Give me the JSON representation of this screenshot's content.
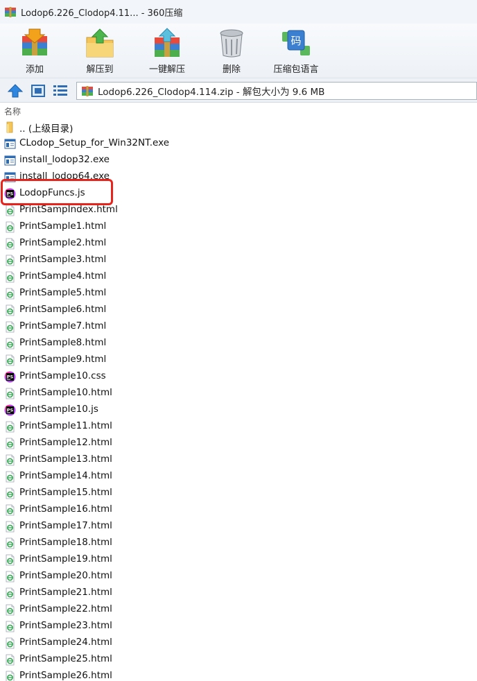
{
  "window": {
    "title": "Lodop6.226_Clodop4.11... - 360压缩"
  },
  "toolbar": {
    "add_label": "添加",
    "extract_to_label": "解压到",
    "one_click_extract_label": "一键解压",
    "delete_label": "删除",
    "encoding_label": "压缩包语言"
  },
  "address": {
    "path": "Lodop6.226_Clodop4.114.zip - 解包大小为 9.6 MB"
  },
  "columns": {
    "name": "名称"
  },
  "files": [
    {
      "name": ".. (上级目录)",
      "icon": "folder-icon"
    },
    {
      "name": "CLodop_Setup_for_Win32NT.exe",
      "icon": "exe-icon"
    },
    {
      "name": "install_lodop32.exe",
      "icon": "exe-icon"
    },
    {
      "name": "install_lodop64.exe",
      "icon": "exe-icon"
    },
    {
      "name": "LodopFuncs.js",
      "icon": "phpstorm-icon"
    },
    {
      "name": "PrintSampIndex.html",
      "icon": "html-icon"
    },
    {
      "name": "PrintSample1.html",
      "icon": "html-icon"
    },
    {
      "name": "PrintSample2.html",
      "icon": "html-icon"
    },
    {
      "name": "PrintSample3.html",
      "icon": "html-icon"
    },
    {
      "name": "PrintSample4.html",
      "icon": "html-icon"
    },
    {
      "name": "PrintSample5.html",
      "icon": "html-icon"
    },
    {
      "name": "PrintSample6.html",
      "icon": "html-icon"
    },
    {
      "name": "PrintSample7.html",
      "icon": "html-icon"
    },
    {
      "name": "PrintSample8.html",
      "icon": "html-icon"
    },
    {
      "name": "PrintSample9.html",
      "icon": "html-icon"
    },
    {
      "name": "PrintSample10.css",
      "icon": "phpstorm-icon"
    },
    {
      "name": "PrintSample10.html",
      "icon": "html-icon"
    },
    {
      "name": "PrintSample10.js",
      "icon": "phpstorm-icon"
    },
    {
      "name": "PrintSample11.html",
      "icon": "html-icon"
    },
    {
      "name": "PrintSample12.html",
      "icon": "html-icon"
    },
    {
      "name": "PrintSample13.html",
      "icon": "html-icon"
    },
    {
      "name": "PrintSample14.html",
      "icon": "html-icon"
    },
    {
      "name": "PrintSample15.html",
      "icon": "html-icon"
    },
    {
      "name": "PrintSample16.html",
      "icon": "html-icon"
    },
    {
      "name": "PrintSample17.html",
      "icon": "html-icon"
    },
    {
      "name": "PrintSample18.html",
      "icon": "html-icon"
    },
    {
      "name": "PrintSample19.html",
      "icon": "html-icon"
    },
    {
      "name": "PrintSample20.html",
      "icon": "html-icon"
    },
    {
      "name": "PrintSample21.html",
      "icon": "html-icon"
    },
    {
      "name": "PrintSample22.html",
      "icon": "html-icon"
    },
    {
      "name": "PrintSample23.html",
      "icon": "html-icon"
    },
    {
      "name": "PrintSample24.html",
      "icon": "html-icon"
    },
    {
      "name": "PrintSample25.html",
      "icon": "html-icon"
    },
    {
      "name": "PrintSample26.html",
      "icon": "html-icon"
    }
  ],
  "highlight_color": "#e8231c"
}
